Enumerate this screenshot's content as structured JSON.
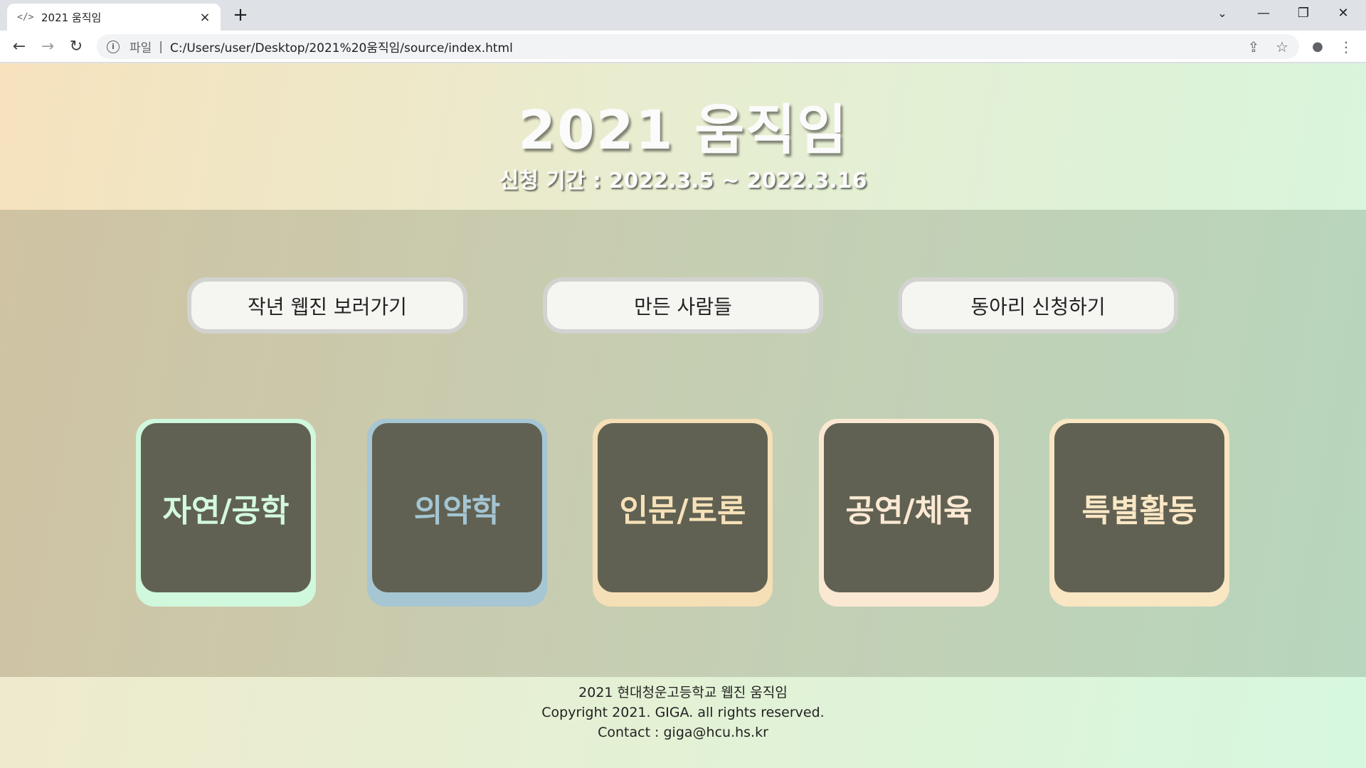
{
  "browser": {
    "tab_title": "2021 움직임",
    "favicon": "</>",
    "tab_close": "×",
    "new_tab": "+",
    "tab_search": "⌄",
    "minimize": "—",
    "restore": "❐",
    "close": "✕",
    "back": "←",
    "forward": "→",
    "reload": "↻",
    "info_icon": "i",
    "scheme": "파일",
    "separator": "|",
    "url": "C:/Users/user/Desktop/2021%20움직임/source/index.html",
    "share": "⇪",
    "star": "☆",
    "profile": "●",
    "menu": "⋮"
  },
  "header": {
    "title": "2021 움직임",
    "period": "신청 기간 : 2022.3.5 ~ 2022.3.16"
  },
  "links": [
    {
      "label": "작년 웹진 보러가기"
    },
    {
      "label": "만든 사람들"
    },
    {
      "label": "동아리 신청하기"
    }
  ],
  "categories": [
    {
      "label": "자연/공학",
      "border_color": "#cff8dd",
      "text_color": "#d3f9de"
    },
    {
      "label": "의약학",
      "border_color": "#a6c6d3",
      "text_color": "#a4c5d2"
    },
    {
      "label": "인문/토론",
      "border_color": "#f5dfb6",
      "text_color": "#f6e1b8"
    },
    {
      "label": "공연/체육",
      "border_color": "#fbe8d2",
      "text_color": "#fce9d3"
    },
    {
      "label": "특별활동",
      "border_color": "#f9e6c3",
      "text_color": "#fae7c4"
    }
  ],
  "footer": {
    "line1": "2021 현대청운고등학교 웹진 움직임",
    "line2": "Copyright 2021. GIGA. all rights reserved.",
    "line3": "Contact : giga@hcu.hs.kr"
  }
}
